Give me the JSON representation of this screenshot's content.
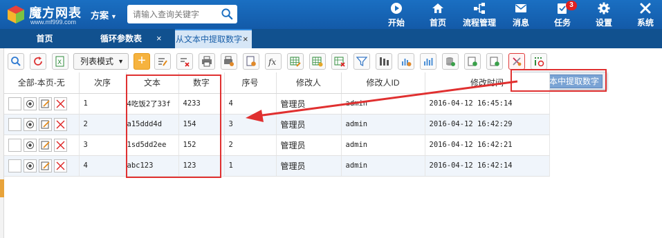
{
  "app": {
    "logo_name": "魔方网表",
    "logo_url": "www.mf999.com",
    "scheme_label": "方案",
    "search_placeholder": "请输入查询关键字"
  },
  "nav": [
    {
      "id": "start",
      "label": "开始",
      "icon": "play-icon"
    },
    {
      "id": "home",
      "label": "首页",
      "icon": "home-icon"
    },
    {
      "id": "workflow",
      "label": "流程管理",
      "icon": "workflow-icon"
    },
    {
      "id": "message",
      "label": "消息",
      "icon": "mail-icon"
    },
    {
      "id": "task",
      "label": "任务",
      "icon": "task-icon",
      "badge": "3"
    },
    {
      "id": "settings",
      "label": "设置",
      "icon": "gear-icon"
    },
    {
      "id": "system",
      "label": "系统",
      "icon": "tools-icon"
    }
  ],
  "tabs": [
    {
      "label": "首页",
      "active": false,
      "closable": false
    },
    {
      "label": "循环参数表",
      "active": false,
      "closable": true
    },
    {
      "label": "从文本中提取数字",
      "active": true,
      "closable": true
    }
  ],
  "toolbar": {
    "list_mode_label": "列表模式",
    "popup_label": "从文本中提取数字"
  },
  "grid": {
    "columns": [
      "全部-本页-无",
      "次序",
      "文本",
      "数字",
      "序号",
      "修改人",
      "修改人ID",
      "修改时间"
    ],
    "rows": [
      {
        "order": "1",
        "text": "4吃饭2了33f",
        "number": "4233",
        "seq": "4",
        "modifier": "管理员",
        "modifier_id": "admin",
        "modified": "2016-04-12 16:45:14"
      },
      {
        "order": "2",
        "text": "a15ddd4d",
        "number": "154",
        "seq": "3",
        "modifier": "管理员",
        "modifier_id": "admin",
        "modified": "2016-04-12 16:42:29"
      },
      {
        "order": "3",
        "text": "1sd5dd2ee",
        "number": "152",
        "seq": "2",
        "modifier": "管理员",
        "modifier_id": "admin",
        "modified": "2016-04-12 16:42:21"
      },
      {
        "order": "4",
        "text": "abc123",
        "number": "123",
        "seq": "1",
        "modifier": "管理员",
        "modifier_id": "admin",
        "modified": "2016-04-12 16:42:14"
      }
    ]
  },
  "colors": {
    "header_blue": "#1a6fc2",
    "tabbar_blue": "#11518f",
    "annotation_red": "#e03030",
    "row_alt": "#f0f5fb"
  }
}
